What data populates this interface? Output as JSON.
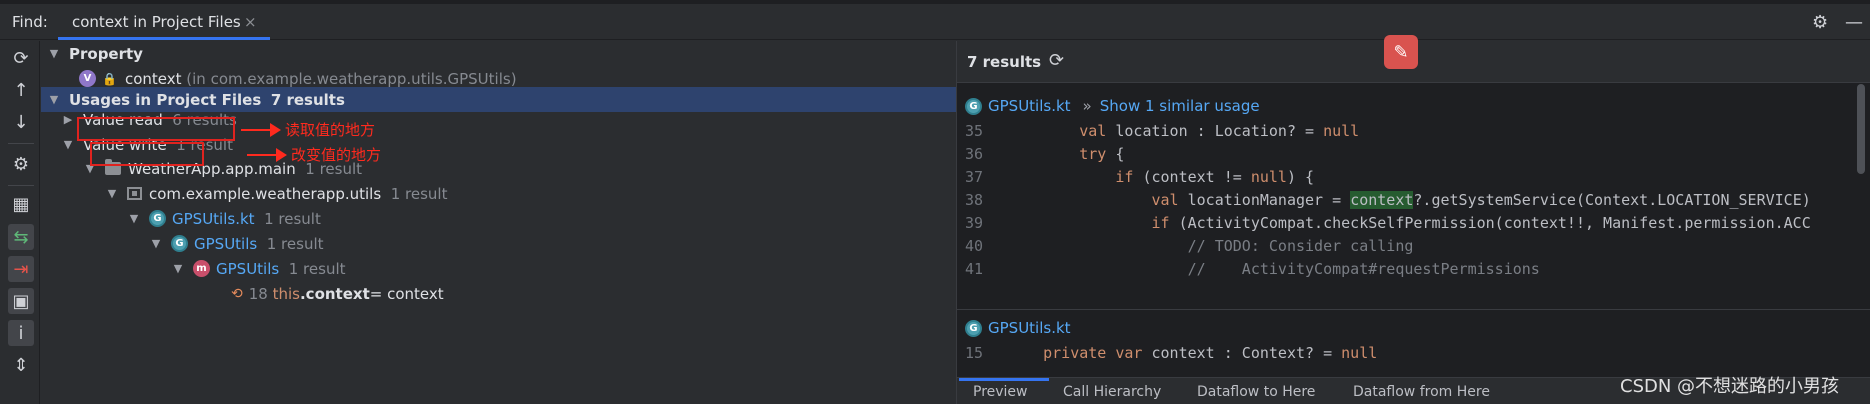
{
  "header": {
    "find_label": "Find:",
    "tab_label": "context in Project Files",
    "close_glyph": "×",
    "settings_glyph": "⚙",
    "minimize_glyph": "—"
  },
  "tree": {
    "property_group": "Property",
    "property_name": "context",
    "property_location": "(in com.example.weatherapp.utils.GPSUtils)",
    "usages_group": "Usages in Project Files",
    "usages_count": "7 results",
    "value_read": "Value read",
    "value_read_count": "6 results",
    "value_write": "Value write",
    "value_write_count": "1 result",
    "module": "WeatherApp.app.main",
    "module_count": "1 result",
    "package": "com.example.weatherapp.utils",
    "package_count": "1 result",
    "file": "GPSUtils.kt",
    "file_count": "1 result",
    "class": "GPSUtils",
    "class_count": "1 result",
    "method": "GPSUtils",
    "method_count": "1 result",
    "usage_line": "18",
    "usage_this": "this",
    "usage_dot_context": ".context",
    "usage_rest": " = context"
  },
  "annotations": {
    "read_note": "读取值的地方",
    "write_note": "改变值的地方"
  },
  "preview": {
    "results": "7 results",
    "file1": "GPSUtils.kt",
    "similar": "Show 1 similar usage",
    "lines": [
      {
        "n": "35",
        "a": "        ",
        "k": "val",
        "b": " location : Location? = ",
        "k2": "null",
        "c": ""
      },
      {
        "n": "36",
        "a": "        ",
        "k": "try",
        "b": " {",
        "k2": "",
        "c": ""
      },
      {
        "n": "37",
        "a": "            ",
        "k": "if",
        "b": " (context != ",
        "k2": "null",
        "c": ") {"
      },
      {
        "n": "38",
        "a": "                ",
        "k": "val",
        "b": " locationManager = ",
        "k2": "",
        "c": "?.getSystemService(Context.LOCATION_SERVICE)"
      },
      {
        "n": "39",
        "a": "                ",
        "k": "if",
        "b": " (ActivityCompat.checkSelfPermission(context!!, Manifest.permission.ACC",
        "k2": "",
        "c": ""
      },
      {
        "n": "40",
        "a": "                    ",
        "k": "",
        "b": "",
        "k2": "",
        "c": "// TODO: Consider calling"
      },
      {
        "n": "41",
        "a": "                    ",
        "k": "",
        "b": "",
        "k2": "",
        "c": "//    ActivityCompat#requestPermissions"
      }
    ],
    "highlight_word": "context",
    "file2": "GPSUtils.kt",
    "line15_num": "15",
    "line15_kw1": "private",
    "line15_kw2": "var",
    "line15_rest": " context : Context? = ",
    "line15_null": "null",
    "bottom_tabs": [
      "Preview",
      "Call Hierarchy",
      "Dataflow to Here",
      "Dataflow from Here"
    ]
  },
  "watermark": "CSDN @不想迷路的小男孩"
}
